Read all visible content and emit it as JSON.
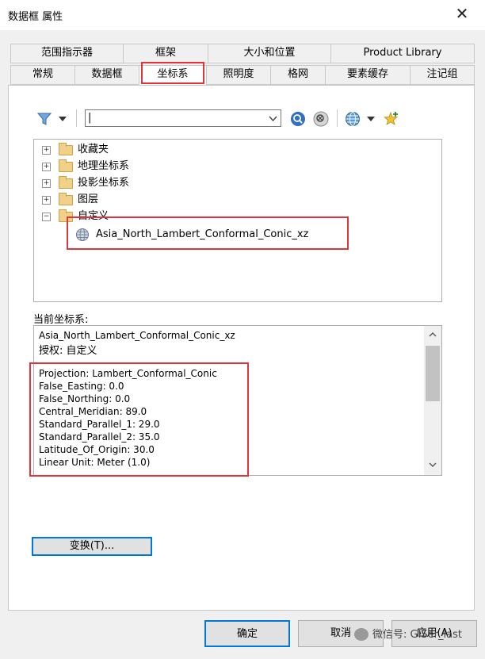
{
  "window": {
    "title": "数据框 属性",
    "close_glyph": "✕"
  },
  "tabs_top": [
    "范围指示器",
    "框架",
    "大小和位置",
    "Product Library"
  ],
  "tabs_bottom": [
    "常规",
    "数据框",
    "坐标系",
    "照明度",
    "格网",
    "要素缓存",
    "注记组"
  ],
  "active_tab": "坐标系",
  "toolbar": {
    "search_value": "|",
    "icons": [
      "filter-icon",
      "chevron-down-icon",
      "search-icon",
      "clear-search-icon",
      "globe-icon",
      "chevron-down-icon",
      "add-favorite-icon"
    ]
  },
  "tree": {
    "items": [
      {
        "label": "收藏夹",
        "expander": "+"
      },
      {
        "label": "地理坐标系",
        "expander": "+"
      },
      {
        "label": "投影坐标系",
        "expander": "+"
      },
      {
        "label": "图层",
        "expander": "+"
      },
      {
        "label": "自定义",
        "expander": "−"
      }
    ],
    "child": "Asia_North_Lambert_Conformal_Conic_xz"
  },
  "current": {
    "label": "当前坐标系:",
    "name": "Asia_North_Lambert_Conformal_Conic_xz",
    "authority": "授权: 自定义",
    "params": [
      "Projection: Lambert_Conformal_Conic",
      "False_Easting: 0.0",
      "False_Northing: 0.0",
      "Central_Meridian: 89.0",
      "Standard_Parallel_1: 29.0",
      "Standard_Parallel_2: 35.0",
      "Latitude_Of_Origin: 30.0",
      "Linear Unit: Meter (1.0)"
    ]
  },
  "buttons": {
    "transform": "变换(T)...",
    "ok": "确定",
    "cancel": "取消",
    "apply": "应用(A)"
  },
  "watermark": "微信号: GISer_last",
  "colors": {
    "highlight": "#e0363a",
    "focus": "#0078d7"
  }
}
